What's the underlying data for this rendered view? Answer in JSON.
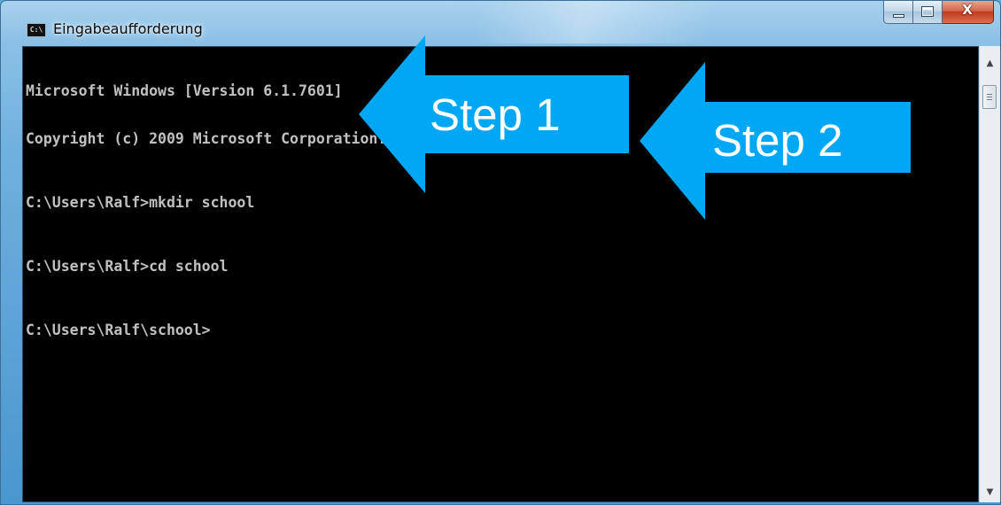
{
  "window": {
    "title": "Eingabeaufforderung",
    "app_icon_text": "C:\\",
    "close_glyph": "X",
    "frame_color": "#6fb0de"
  },
  "console": {
    "lines": [
      "Microsoft Windows [Version 6.1.7601]",
      "Copyright (c) 2009 Microsoft Corporation. Alle Rechte vorbehalten.",
      "C:\\Users\\Ralf>mkdir school",
      "C:\\Users\\Ralf>cd school",
      "C:\\Users\\Ralf\\school>"
    ],
    "text_color": "#c0c0c0",
    "background": "#000000"
  },
  "scrollbar": {
    "up_arrow": "▲",
    "down_arrow": "▼"
  },
  "callouts": {
    "step1_label": "Step 1",
    "step2_label": "Step 2",
    "color": "#00a7f5"
  },
  "icons": {
    "app": "cmd-icon",
    "minimize": "minimize-icon",
    "maximize": "maximize-icon",
    "close": "close-icon"
  }
}
